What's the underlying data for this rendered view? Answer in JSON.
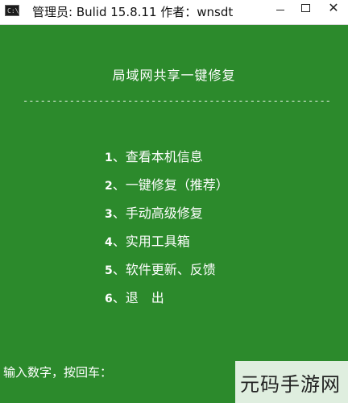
{
  "titlebar": {
    "icon": "terminal-icon",
    "icon_glyph": "C:\\",
    "title": "管理员: Bulid 15.8.11  作者：wnsdt",
    "minimize_icon": "minimize-icon",
    "maximize_icon": "maximize-icon",
    "close_icon": "close-icon",
    "close_glyph": "✕"
  },
  "console": {
    "background": "#2c8a2c",
    "heading": "局域网共享一键修复",
    "divider": "--------------------------------------------------------",
    "menu": [
      {
        "num": "1",
        "label": "、查看本机信息"
      },
      {
        "num": "2",
        "label": "、一键修复（推荐）"
      },
      {
        "num": "3",
        "label": "、手动高级修复"
      },
      {
        "num": "4",
        "label": "、实用工具箱"
      },
      {
        "num": "5",
        "label": "、软件更新、反馈"
      },
      {
        "num": "6",
        "label": "、退　出"
      }
    ],
    "prompt": "输入数字，按回车："
  },
  "watermark": {
    "text": "元码手游网"
  }
}
